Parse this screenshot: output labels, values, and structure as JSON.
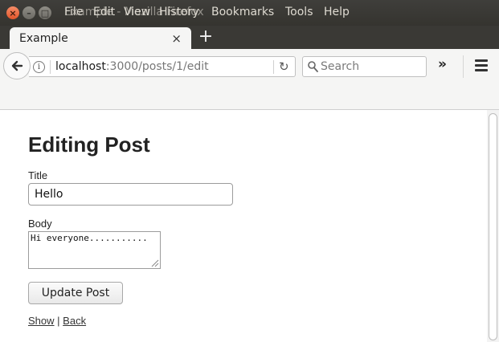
{
  "window": {
    "menu_items": [
      "File",
      "Edit",
      "View",
      "History",
      "Bookmarks",
      "Tools",
      "Help"
    ],
    "overlay_title": "Example - Mozilla Firefox"
  },
  "tab": {
    "title": "Example",
    "close_glyph": "×",
    "new_tab_glyph": "+"
  },
  "nav": {
    "url_host": "localhost",
    "url_path": ":3000/posts/1/edit",
    "search_placeholder": "Search",
    "overflow_glyph": "»"
  },
  "page": {
    "heading": "Editing Post",
    "title_label": "Title",
    "title_value": "Hello",
    "body_label": "Body",
    "body_value": "Hi everyone...........",
    "submit_label": "Update Post",
    "show_link": "Show",
    "separator": "|",
    "back_link": "Back"
  },
  "icons": {
    "info": "i",
    "reload": "↻"
  },
  "colors": {
    "titlebar": "#3f3e3b",
    "close_button": "#e2562a",
    "toolbar": "#f5f5f4"
  }
}
